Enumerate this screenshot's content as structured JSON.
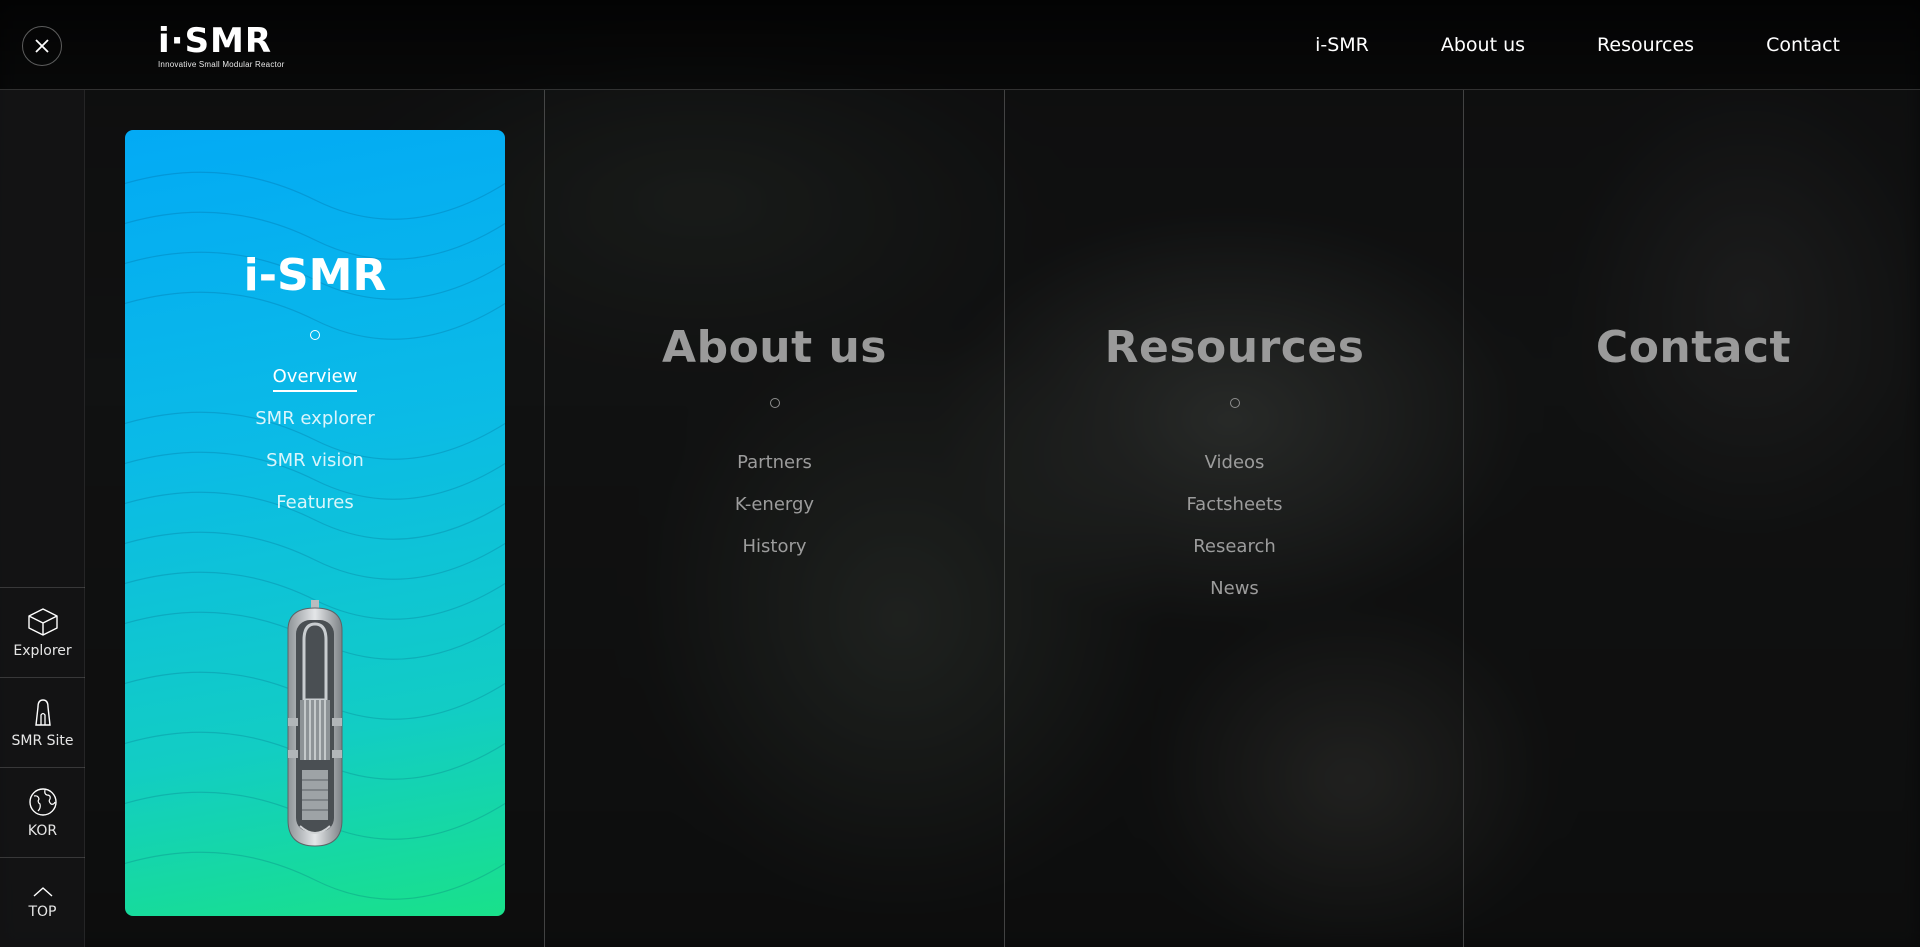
{
  "logo": {
    "mark": "i·SMR",
    "tagline": "Innovative Small Modular Reactor"
  },
  "top_nav": [
    "i-SMR",
    "About us",
    "Resources",
    "Contact"
  ],
  "rail": {
    "items": [
      {
        "label": "Explorer",
        "icon": "cube-icon"
      },
      {
        "label": "SMR Site",
        "icon": "tower-icon"
      },
      {
        "label": "KOR",
        "icon": "globe-icon"
      },
      {
        "label": "TOP",
        "icon": "chevron-up-icon"
      }
    ]
  },
  "card": {
    "title": "i-SMR",
    "items": [
      "Overview",
      "SMR explorer",
      "SMR vision",
      "Features"
    ],
    "active_item": "Overview",
    "colors": {
      "top": "#03aaf5",
      "bottom": "#19e18a"
    }
  },
  "columns": [
    {
      "title": "About us",
      "items": [
        "Partners",
        "K-energy",
        "History"
      ]
    },
    {
      "title": "Resources",
      "items": [
        "Videos",
        "Factsheets",
        "Research",
        "News"
      ]
    },
    {
      "title": "Contact",
      "items": []
    }
  ]
}
